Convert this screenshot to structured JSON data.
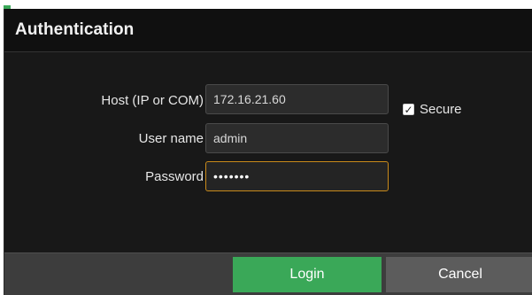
{
  "dialog": {
    "title": "Authentication"
  },
  "form": {
    "host": {
      "label": "Host (IP or COM)",
      "value": "172.16.21.60"
    },
    "secure": {
      "label": "Secure",
      "checked": true,
      "check_glyph": "✓"
    },
    "username": {
      "label": "User name",
      "value": "admin"
    },
    "password": {
      "label": "Password",
      "masked_value": "•••••••"
    }
  },
  "buttons": {
    "login_label": "Login",
    "cancel_label": "Cancel"
  },
  "colors": {
    "accent_green": "#3aa858",
    "focus_orange": "#c98a1a",
    "dialog_bg": "#181818",
    "footer_bg": "#3d3d3d"
  }
}
